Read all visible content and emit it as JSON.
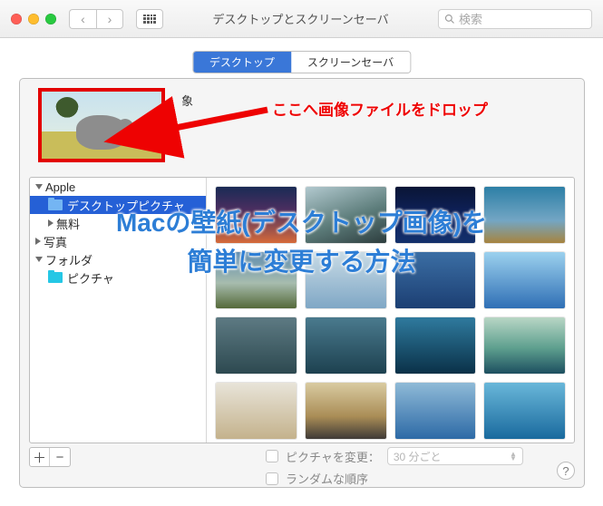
{
  "window": {
    "title": "デスクトップとスクリーンセーバ"
  },
  "search": {
    "placeholder": "検索"
  },
  "tabs": {
    "desktop": "デスクトップ",
    "screensaver": "スクリーンセーバ"
  },
  "preview": {
    "name": "象"
  },
  "sidebar": {
    "groups": [
      {
        "label": "Apple",
        "open": true
      },
      {
        "label": "デスクトップピクチャ",
        "selected": true,
        "folder": "blue"
      },
      {
        "label": "無料",
        "open": false
      },
      {
        "label": "写真",
        "open": false
      },
      {
        "label": "フォルダ",
        "open": true
      },
      {
        "label": "ピクチャ",
        "folder": "cyan"
      }
    ]
  },
  "thumbnails": [
    "linear-gradient(#1a2b55,#4a2e60 40%,#d66a3a)",
    "linear-gradient(160deg,#b2c9cf,#5d7d7b 55%,#2d3d3e)",
    "linear-gradient(#0a1535,#0f2360 55%,#13306b)",
    "linear-gradient(#2d7fa6,#73a6c4 60%,#a7843f)",
    "linear-gradient(#5d8baf,#a7bcae 55%,#556a3a)",
    "linear-gradient(#c8dbe6,#7fa7c5)",
    "linear-gradient(#3b6ea4,#1c3f73)",
    "linear-gradient(#9cd1ee,#2f6fb5)",
    "linear-gradient(#5d7a83,#2d4950)",
    "linear-gradient(#4a7a8e,#1d4150)",
    "linear-gradient(#2f7a9e,#0a3148)",
    "linear-gradient(#b8d6c5,#5d9f8e 55%,#1d4f60)",
    "linear-gradient(#e8e4d9,#c4b28c)",
    "linear-gradient(#d9cba1,#aa8d56 60%,#3f3a37)",
    "linear-gradient(#8fbad7,#2d6aa6)",
    "linear-gradient(#69b7d9,#1a6a9e)"
  ],
  "footer": {
    "add": "＋",
    "remove": "−",
    "change_label": "ピクチャを変更：",
    "interval": "30 分ごと",
    "random_label": "ランダムな順序"
  },
  "annotation": {
    "drop_hint": "ここへ画像ファイルをドロップ",
    "headline_l1": "Macの壁紙(デスクトップ画像)を",
    "headline_l2": "簡単に変更する方法"
  }
}
